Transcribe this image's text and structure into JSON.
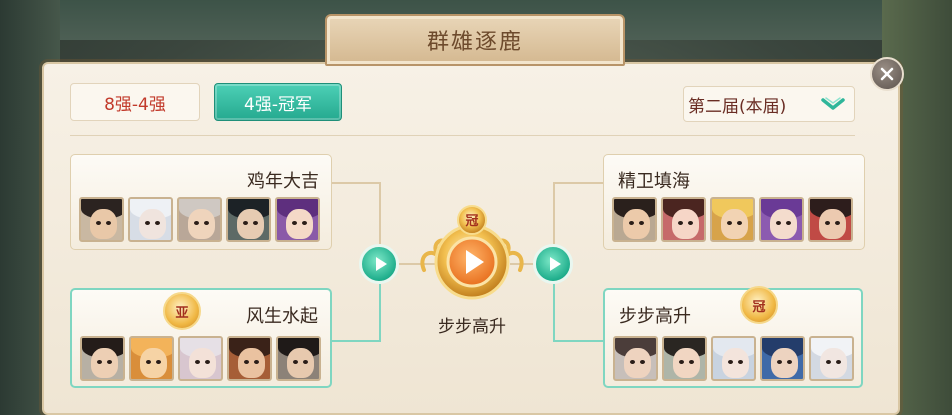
{
  "title": "群雄逐鹿",
  "tabs": [
    {
      "label": "8强-4强",
      "active": false
    },
    {
      "label": "4强-冠军",
      "active": true
    }
  ],
  "season_select": {
    "label": "第二届(本届)"
  },
  "colors": {
    "accent": "#25a98f",
    "tab_inactive_text": "#c23a2b",
    "bracket_line": "#dcc9a7",
    "winner_line": "#7fd6c1"
  },
  "left_bracket": {
    "top_team": {
      "name": "鸡年大吉"
    },
    "bottom_team": {
      "name": "风生水起",
      "badge": "亚"
    }
  },
  "right_bracket": {
    "top_team": {
      "name": "精卫填海"
    },
    "bottom_team": {
      "name": "步步高升",
      "badge": "冠"
    }
  },
  "final": {
    "trophy_label": "冠",
    "champion_name": "步步高升"
  },
  "icons": {
    "close": "close-icon",
    "season_dropdown": "chevron-down-icon",
    "play": "play-icon",
    "trophy": "trophy-play-icon"
  }
}
